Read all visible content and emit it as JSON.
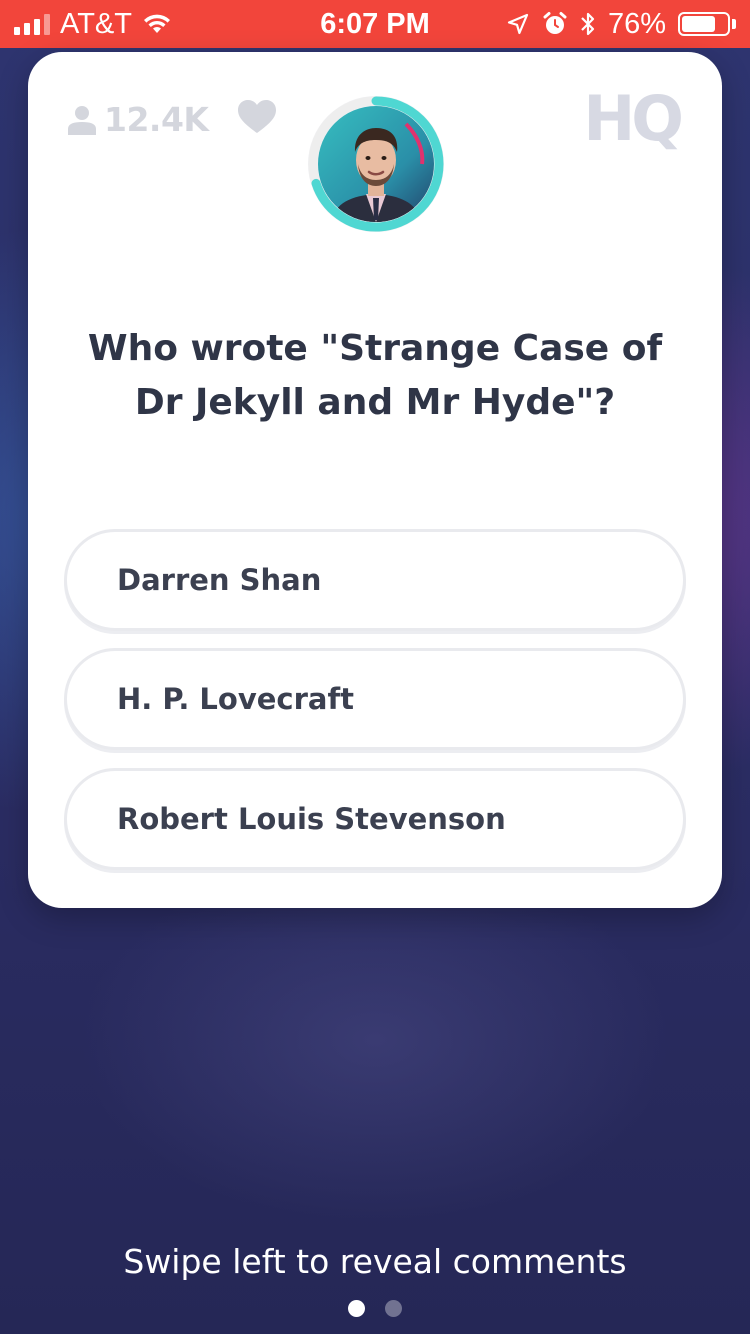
{
  "status_bar": {
    "carrier": "AT&T",
    "time": "6:07 PM",
    "battery_percent": "76%",
    "battery_level": 0.76,
    "icons": [
      "signal-icon",
      "wifi-icon",
      "location-arrow-icon",
      "alarm-icon",
      "bluetooth-icon",
      "battery-icon"
    ]
  },
  "card": {
    "viewer_count": "12.4K",
    "logo": "HQ",
    "timer_progress": 0.7,
    "colors": {
      "timer_ring": "#4fd7d2",
      "timer_track": "#eeeeee",
      "text": "#2f3547",
      "muted": "#d4d6dd"
    },
    "question": "Who wrote \"Strange Case of Dr Jekyll and Mr Hyde\"?",
    "answers": [
      {
        "label": "Darren Shan"
      },
      {
        "label": "H. P. Lovecraft"
      },
      {
        "label": "Robert Louis Stevenson"
      }
    ]
  },
  "footer": {
    "swipe_hint": "Swipe left to reveal comments",
    "pages": 2,
    "active_page": 0
  },
  "theme": {
    "status_bar_bg": "#f2453b",
    "background": "#2b2d64"
  }
}
